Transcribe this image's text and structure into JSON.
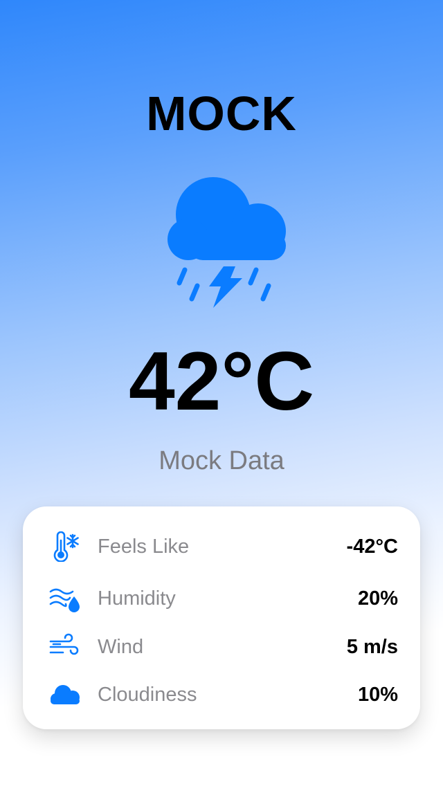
{
  "location": {
    "city": "MOCK"
  },
  "current": {
    "condition_icon": "cloud-bolt-rain-icon",
    "temperature": "42°C",
    "description": "Mock Data"
  },
  "details": [
    {
      "icon": "thermometer-snowflake-icon",
      "label": "Feels Like",
      "value": "-42°C"
    },
    {
      "icon": "humidity-icon",
      "label": "Humidity",
      "value": "20%"
    },
    {
      "icon": "wind-icon",
      "label": "Wind",
      "value": "5 m/s"
    },
    {
      "icon": "cloud-icon",
      "label": "Cloudiness",
      "value": "10%"
    }
  ],
  "colors": {
    "accent": "#0a7cff",
    "gradient_top": "#2f87fb",
    "gradient_bottom": "#ffffff",
    "label_gray": "#8a8a8e",
    "description_gray": "#7b7b80"
  }
}
